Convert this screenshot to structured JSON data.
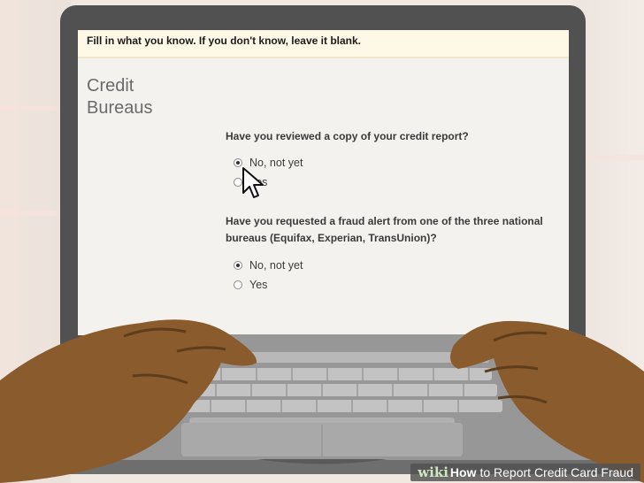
{
  "banner": {
    "text": "Fill in what you know. If you don't know, leave it blank."
  },
  "section": {
    "title_line1": "Credit",
    "title_line2": "Bureaus"
  },
  "questions": [
    {
      "text": "Have you reviewed a copy of your credit report?",
      "options": [
        {
          "label": "No, not yet",
          "checked": true
        },
        {
          "label": "Yes",
          "checked": false
        }
      ]
    },
    {
      "text_line1": "Have you requested a fraud alert from one of the three national",
      "text_line2": "bureaus (Equifax, Experian, TransUnion)?",
      "options": [
        {
          "label": "No, not yet",
          "checked": true
        },
        {
          "label": "Yes",
          "checked": false
        }
      ]
    }
  ],
  "watermark": {
    "wiki": "wiki",
    "how": "How",
    "rest": "to Report Credit Card Fraud"
  },
  "colors": {
    "screen_bg": "#f4f2ef",
    "banner_bg": "#fdf9e6",
    "laptop_body": "#515151",
    "skin": "#8a5b2c"
  }
}
